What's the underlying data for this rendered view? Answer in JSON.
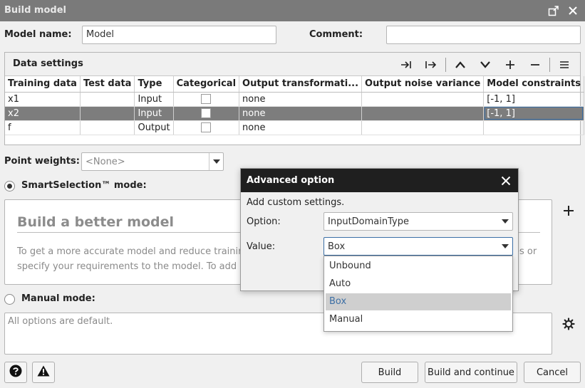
{
  "window": {
    "title": "Build model"
  },
  "form": {
    "model_name_label": "Model name:",
    "model_name_value": "Model",
    "comment_label": "Comment:",
    "comment_value": ""
  },
  "data_settings": {
    "title": "Data settings",
    "columns": [
      "Training data",
      "Test data",
      "Type",
      "Categorical",
      "Output transformati...",
      "Output noise variance",
      "Model constraints"
    ],
    "rows": [
      {
        "training": "x1",
        "test": "",
        "type": "Input",
        "categorical": false,
        "transform": "none",
        "noise": "",
        "constraints": "[-1, 1]"
      },
      {
        "training": "x2",
        "test": "",
        "type": "Input",
        "categorical": false,
        "transform": "none",
        "noise": "",
        "constraints": "[-1, 1]"
      },
      {
        "training": "f",
        "test": "",
        "type": "Output",
        "categorical": false,
        "transform": "none",
        "noise": "",
        "constraints": ""
      }
    ],
    "selected_row": 1
  },
  "point_weights": {
    "label": "Point weights:",
    "placeholder": "<None>"
  },
  "smart_selection": {
    "label": "SmartSelection™ mode:",
    "selected": true,
    "heading": "Build a better model",
    "text_line1": "To get a more accurate model and reduce training ti",
    "text_line1_tail": "es or",
    "text_line2": "specify your requirements to the model. To add a hi"
  },
  "manual_mode": {
    "label": "Manual mode:",
    "selected": false,
    "placeholder": "All options are default."
  },
  "buttons": {
    "build": "Build",
    "build_continue": "Build and continue",
    "cancel": "Cancel"
  },
  "advanced_dialog": {
    "title": "Advanced option",
    "subtitle": "Add custom settings.",
    "option_label": "Option:",
    "option_value": "InputDomainType",
    "value_label": "Value:",
    "value_value": "Box",
    "options": [
      "Unbound",
      "Auto",
      "Box",
      "Manual"
    ],
    "selected_index": 2
  },
  "colors": {
    "title_bar": "#7a7a7a",
    "dialog_header": "#1f1f1f",
    "selected_row": "#7d7d7d",
    "selected_option_text": "#3d6fa5"
  }
}
